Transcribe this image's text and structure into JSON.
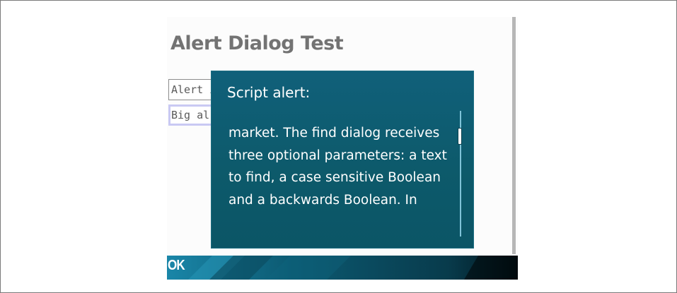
{
  "page": {
    "title": "Alert Dialog Test"
  },
  "buttons": {
    "alert_label": "Alert i",
    "big_alert_label": "Big al"
  },
  "dialog": {
    "title": "Script alert:",
    "message": "market. The find dialog receives three optional parameters: a text to find, a case sensitive Boolean and a backwards Boolean. In"
  },
  "softkeys": {
    "left_label": "OK"
  },
  "colors": {
    "dialog_bg": "#0d5a6b",
    "softkey_bar": "#073a4c",
    "title_gray": "#737373"
  },
  "icons": {
    "dialog_scrollbar": "vertical-scrollbar-icon"
  }
}
